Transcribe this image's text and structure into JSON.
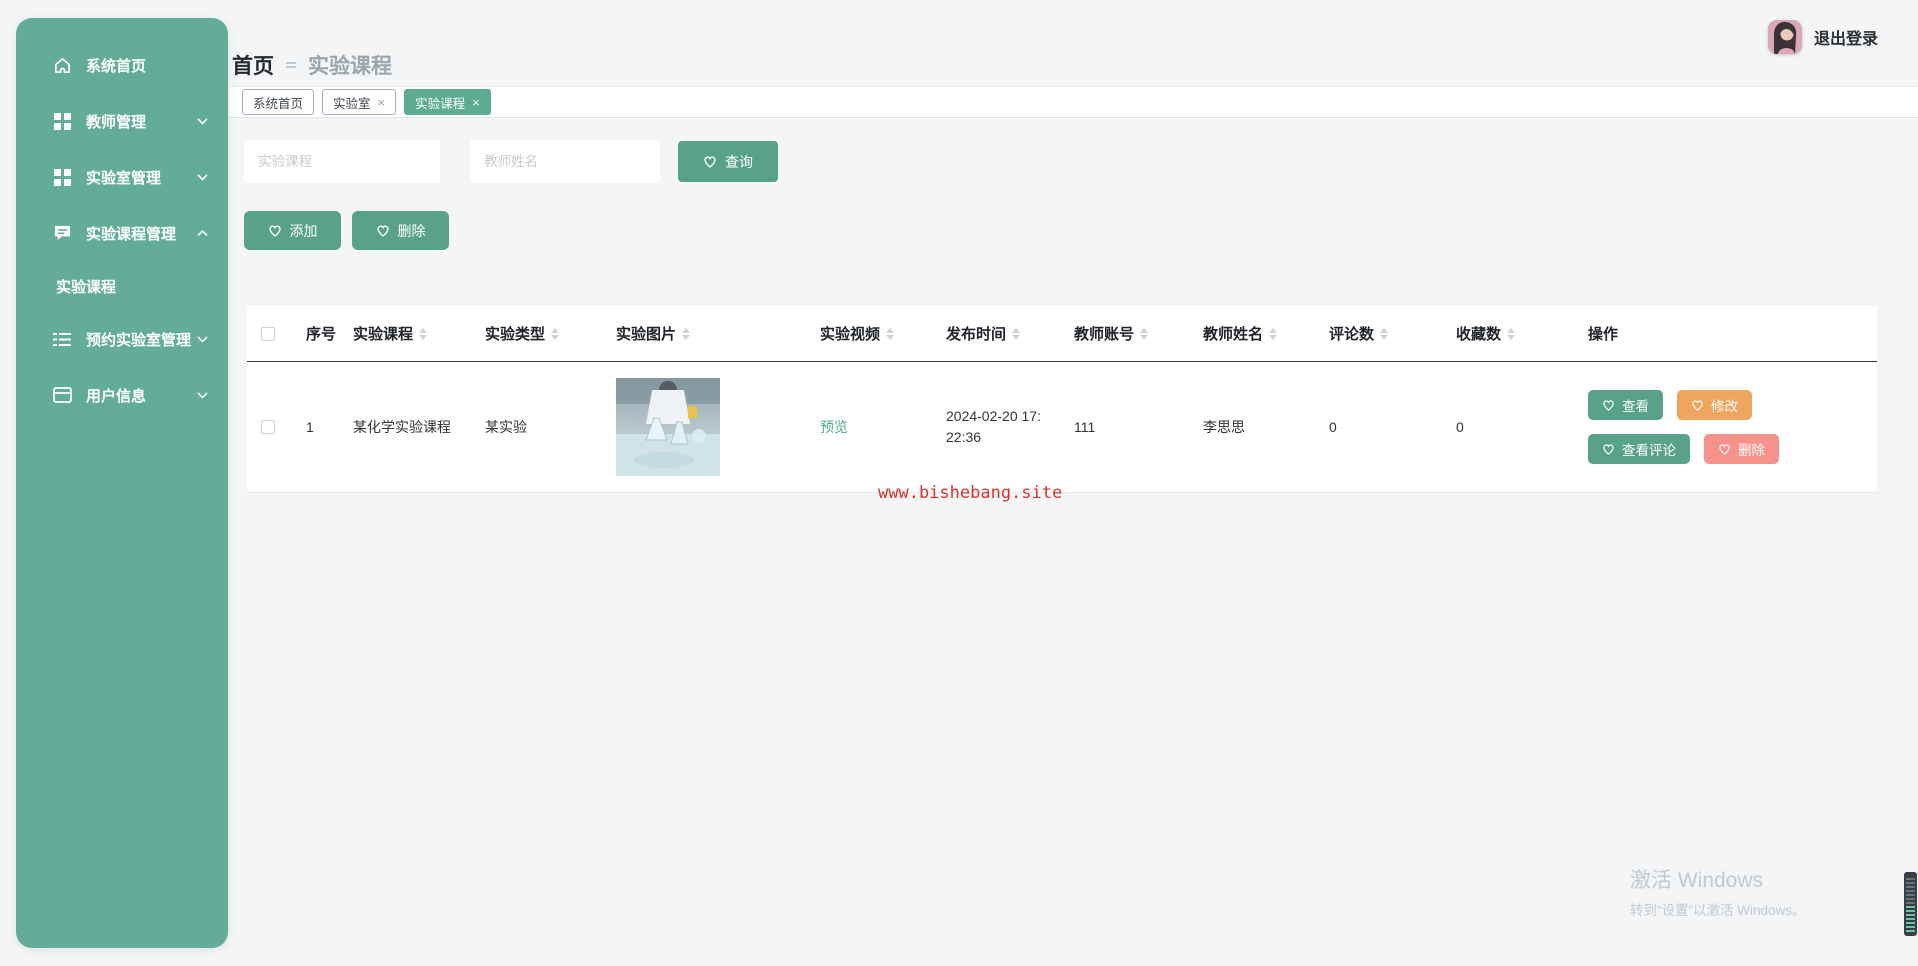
{
  "sidebar": {
    "items": [
      {
        "label": "系统首页",
        "icon": "home-icon"
      },
      {
        "label": "教师管理",
        "icon": "grid-icon",
        "chevron": "down"
      },
      {
        "label": "实验室管理",
        "icon": "grid-icon",
        "chevron": "down"
      },
      {
        "label": "实验课程管理",
        "icon": "chat-icon",
        "chevron": "up",
        "children": [
          {
            "label": "实验课程",
            "active": true
          }
        ]
      },
      {
        "label": "预约实验室管理",
        "icon": "list-icon",
        "chevron": "down"
      },
      {
        "label": "用户信息",
        "icon": "card-icon",
        "chevron": "down"
      }
    ]
  },
  "breadcrumb": {
    "home": "首页",
    "current": "实验课程"
  },
  "header": {
    "logout": "退出登录"
  },
  "tabs": [
    {
      "label": "系统首页",
      "closable": false,
      "active": false
    },
    {
      "label": "实验室",
      "closable": true,
      "active": false
    },
    {
      "label": "实验课程",
      "closable": true,
      "active": true
    }
  ],
  "search": {
    "course_placeholder": "实验课程",
    "teacher_placeholder": "教师姓名",
    "query_label": "查询"
  },
  "toolbar": {
    "add_label": "添加",
    "delete_label": "删除"
  },
  "table": {
    "headers": [
      "序号",
      "实验课程",
      "实验类型",
      "实验图片",
      "实验视频",
      "发布时间",
      "教师账号",
      "教师姓名",
      "评论数",
      "收藏数",
      "操作"
    ],
    "rows": [
      {
        "index": "1",
        "course": "某化学实验课程",
        "type": "某实验",
        "image": "chemistry-lab-photo",
        "video_link": "预览",
        "publish_time": "2024-02-20 17:22:36",
        "teacher_account": "111",
        "teacher_name": "李思思",
        "comments": "0",
        "favorites": "0"
      }
    ]
  },
  "row_actions": {
    "view": "查看",
    "edit": "修改",
    "comments": "查看评论",
    "delete": "删除"
  },
  "watermark": "www.bishebang.site",
  "windows_activation": {
    "line1": "激活 Windows",
    "line2": "转到“设置”以激活 Windows。"
  },
  "colors": {
    "sidebar_green": "#63ac97",
    "button_green": "#57a289",
    "active_tab_green": "#5dab91",
    "edit_orange": "#f0a55e",
    "delete_pink": "#f5928b",
    "link_green": "#4faa82",
    "watermark_red": "#d3342e",
    "background": "#f3f5f7"
  }
}
